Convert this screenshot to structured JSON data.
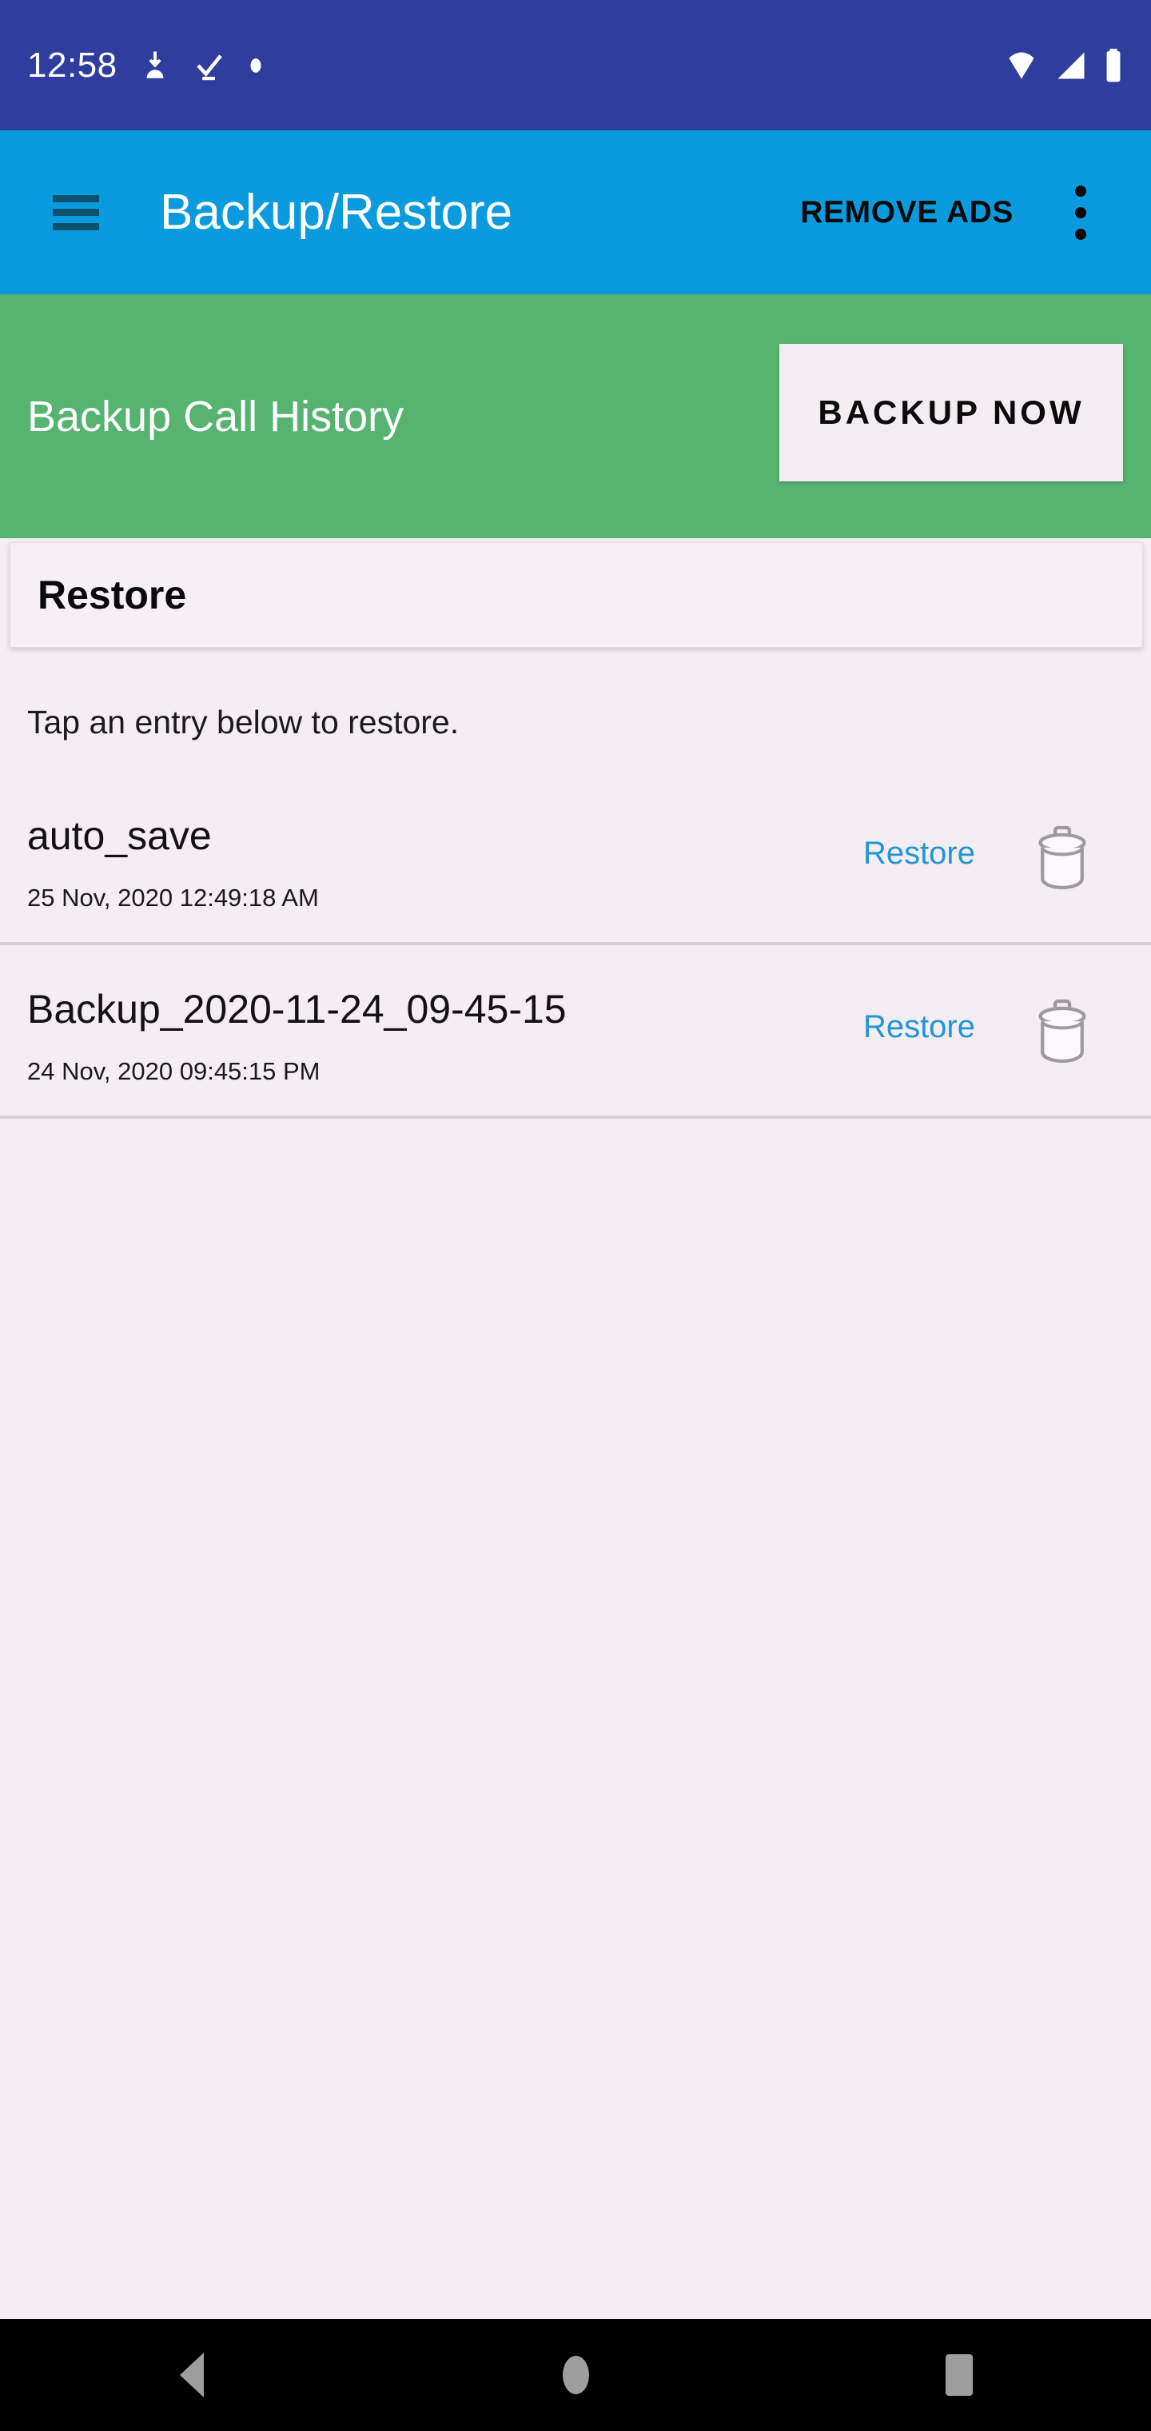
{
  "status_bar": {
    "time": "12:58",
    "left_icons": [
      "download-icon",
      "check-icon",
      "dot-icon"
    ],
    "right_icons": [
      "wifi-icon",
      "signal-icon",
      "battery-icon"
    ],
    "background_color": "#2F3E9E"
  },
  "app_bar": {
    "menu_icon": "hamburger-menu-icon",
    "title": "Backup/Restore",
    "remove_ads_label": "REMOVE ADS",
    "overflow_icon": "more-vertical-icon",
    "background_color": "#0A9BDE"
  },
  "banner": {
    "title": "Backup Call History",
    "button_label": "BACKUP NOW",
    "background_color": "#56B370"
  },
  "restore_section": {
    "header": "Restore",
    "hint": "Tap an entry below to restore.",
    "restore_link_color": "#2196D4"
  },
  "backups": [
    {
      "name": "auto_save",
      "date": "25 Nov, 2020 12:49:18 AM",
      "restore_label": "Restore",
      "delete_icon": "trash-icon"
    },
    {
      "name": "Backup_2020-11-24_09-45-15",
      "date": "24 Nov, 2020 09:45:15 PM",
      "restore_label": "Restore",
      "delete_icon": "trash-icon"
    }
  ],
  "nav_bar": {
    "back_icon": "back-triangle-icon",
    "home_icon": "home-circle-icon",
    "recents_icon": "recents-square-icon"
  }
}
